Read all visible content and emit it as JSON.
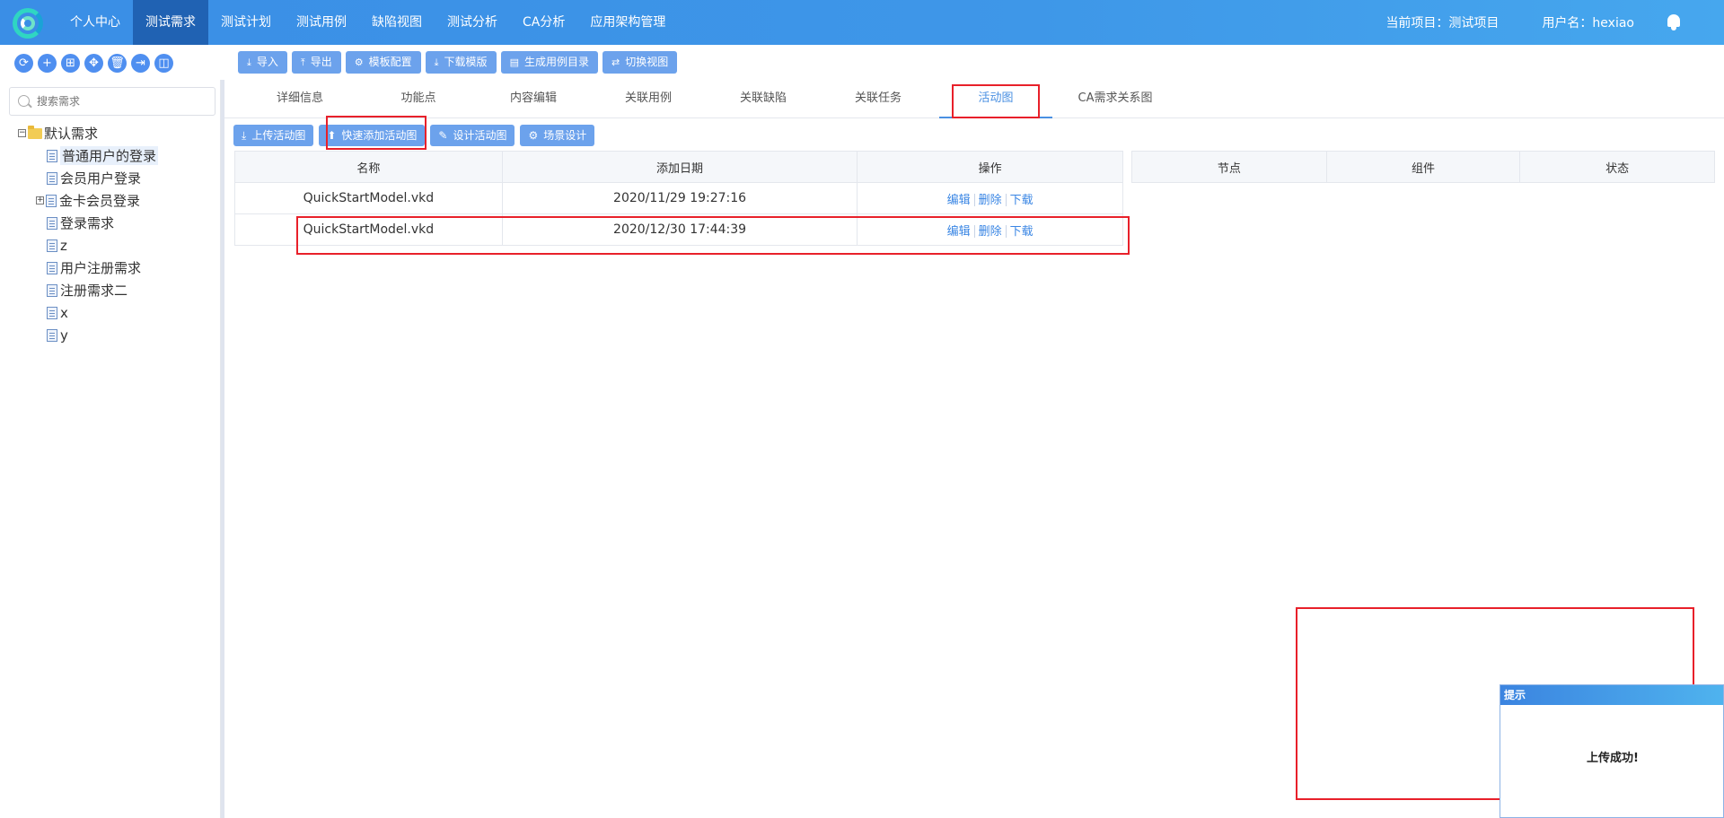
{
  "nav": {
    "items": [
      "个人中心",
      "测试需求",
      "测试计划",
      "测试用例",
      "缺陷视图",
      "测试分析",
      "CA分析",
      "应用架构管理"
    ],
    "active_index": 1,
    "current_project": "当前项目：测试项目",
    "username": "用户名：hexiao"
  },
  "tree_tools": [
    "⟳",
    "+",
    "⊞",
    "✥",
    "🗑",
    "⇥",
    "◫"
  ],
  "toolbar": {
    "import": "导入",
    "export": "导出",
    "template_config": "模板配置",
    "download_template": "下载模版",
    "generate_case_dir": "生成用例目录",
    "switch_view": "切换视图"
  },
  "sidebar": {
    "search_placeholder": "搜索需求",
    "root": "默认需求",
    "items": [
      {
        "label": "普通用户的登录",
        "selected": true
      },
      {
        "label": "会员用户登录"
      },
      {
        "label": "金卡会员登录",
        "expandable": true
      },
      {
        "label": "登录需求"
      },
      {
        "label": "z"
      },
      {
        "label": "用户注册需求"
      },
      {
        "label": "注册需求二"
      },
      {
        "label": "x"
      },
      {
        "label": "y"
      }
    ]
  },
  "tabs": [
    "详细信息",
    "功能点",
    "内容编辑",
    "关联用例",
    "关联缺陷",
    "关联任务",
    "活动图",
    "CA需求关系图"
  ],
  "active_tab": 6,
  "sub_toolbar": {
    "upload": "上传活动图",
    "quick_add": "快速添加活动图",
    "design": "设计活动图",
    "scene": "场景设计"
  },
  "activity_table": {
    "columns": [
      "名称",
      "添加日期",
      "操作"
    ],
    "rows": [
      {
        "name": "QuickStartModel.vkd",
        "date": "2020/11/29 19:27:16"
      },
      {
        "name": "QuickStartModel.vkd",
        "date": "2020/12/30 17:44:39"
      }
    ],
    "ops": {
      "edit": "编辑",
      "delete": "删除",
      "download": "下载"
    }
  },
  "node_table": {
    "columns": [
      "节点",
      "组件",
      "状态"
    ]
  },
  "toast": {
    "title": "提示",
    "message": "上传成功!"
  },
  "colors": {
    "nav_gradient_start": "#3a8ee6",
    "nav_active": "#2062b3",
    "button": "#6ca2ec",
    "highlight": "#e8202a",
    "link": "#3a86e4"
  }
}
